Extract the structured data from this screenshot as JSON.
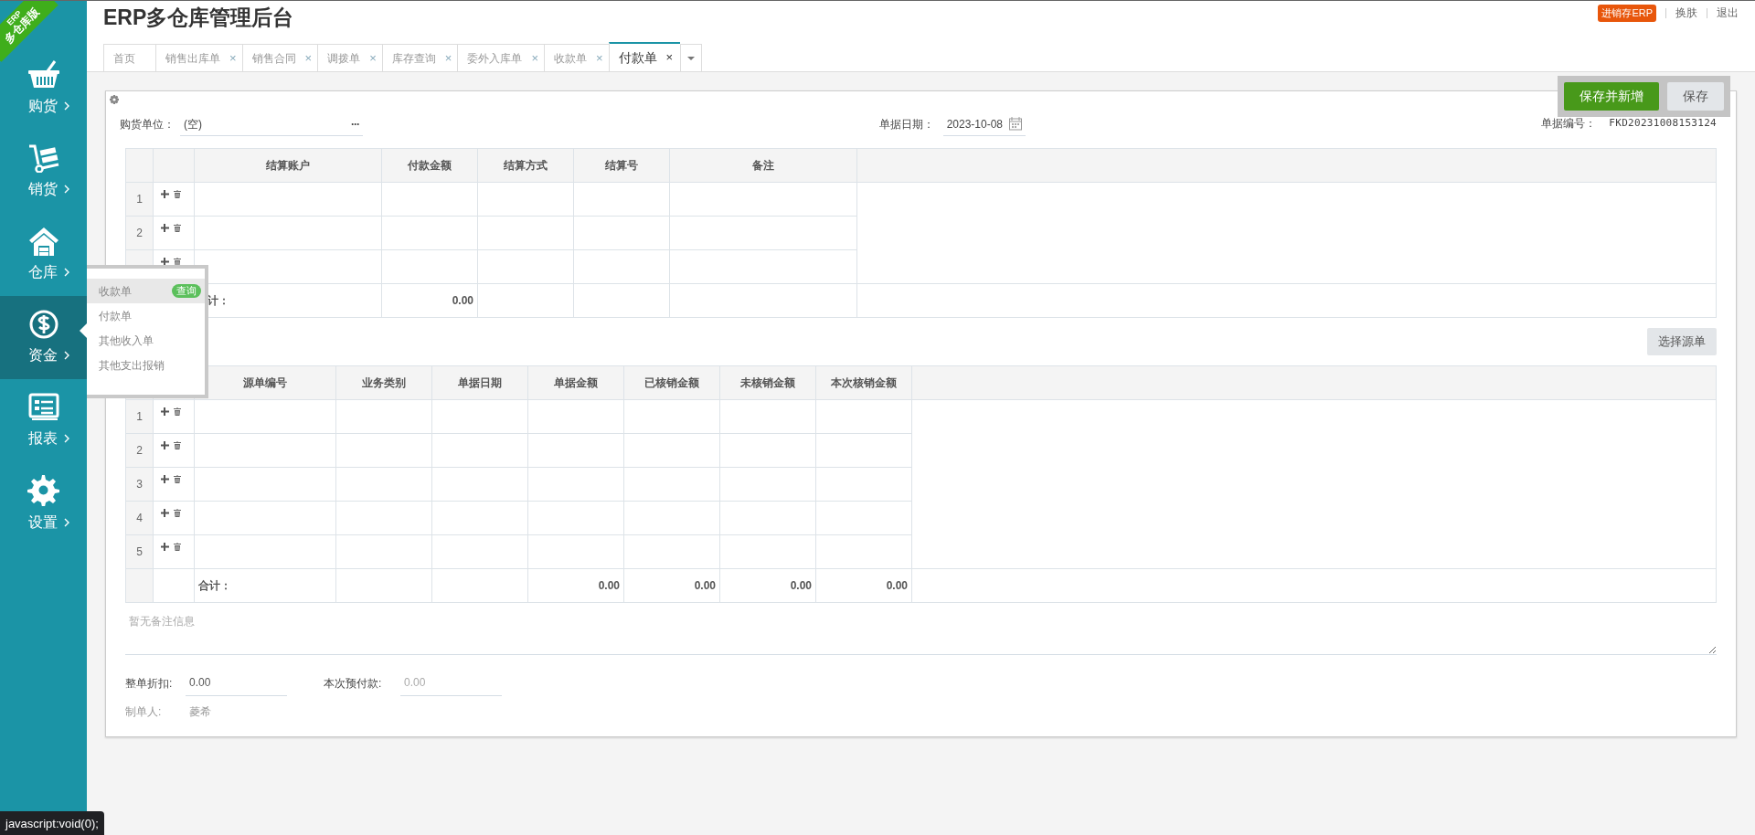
{
  "window": {
    "title": "ERP多仓库管理后台"
  },
  "corner_ribbon": {
    "line_1": "ERP",
    "line_2": "多仓库版"
  },
  "top_links": {
    "badge": "进销存ERP",
    "links": [
      "换肤",
      "退出"
    ]
  },
  "sidebar": {
    "items": [
      {
        "label": "购货",
        "selected": false
      },
      {
        "label": "销货",
        "selected": false
      },
      {
        "label": "仓库",
        "selected": false
      },
      {
        "label": "资金",
        "selected": true
      },
      {
        "label": "报表",
        "selected": false
      },
      {
        "label": "设置",
        "selected": false
      }
    ]
  },
  "flyout_menu": {
    "items": [
      {
        "label": "收款单",
        "highlighted": true,
        "badge": "查询"
      },
      {
        "label": "付款单",
        "highlighted": false
      },
      {
        "label": "其他收入单",
        "highlighted": false
      },
      {
        "label": "其他支出报销",
        "highlighted": false
      }
    ]
  },
  "tabs": [
    {
      "label": "首页",
      "selected": false
    },
    {
      "label": "销售出库单",
      "selected": false,
      "close": "×"
    },
    {
      "label": "销售合同",
      "selected": false,
      "close": "×"
    },
    {
      "label": "调拨单",
      "selected": false,
      "close": "×"
    },
    {
      "label": "库存查询",
      "selected": false,
      "close": "×"
    },
    {
      "label": "委外入库单",
      "selected": false,
      "close": "×"
    },
    {
      "label": "收款单",
      "selected": false,
      "close": "×"
    },
    {
      "label": "付款单",
      "selected": true,
      "close": "×"
    }
  ],
  "toolbar": {
    "buttons": [
      {
        "label": "保存并新增",
        "kind": "primary"
      },
      {
        "label": "保存",
        "kind": "secondary"
      }
    ]
  },
  "form": {
    "supplier": {
      "label": "购货单位：",
      "value": "(空)",
      "more": "···"
    },
    "date": {
      "label": "单据日期：",
      "value": "2023-10-08"
    },
    "number": {
      "label": "单据编号：",
      "value": "FKD20231008153124"
    }
  },
  "settlement_table": {
    "columns": [
      {
        "title": "结算账户"
      },
      {
        "title": "付款金额",
        "total": "0.00"
      },
      {
        "title": "结算方式"
      },
      {
        "title": "结算号"
      },
      {
        "title": "备注"
      }
    ],
    "rows": [
      {
        "number": "1"
      },
      {
        "number": "2"
      },
      {}
    ],
    "total_label": "计："
  },
  "select_source_button": "选择源单",
  "source_table": {
    "columns": [
      {
        "title": "源单编号"
      },
      {
        "title": "业务类别"
      },
      {
        "title": "单据日期"
      },
      {
        "title": "单据金额",
        "total": "0.00"
      },
      {
        "title": "已核销金额",
        "total": "0.00"
      },
      {
        "title": "未核销金额",
        "total": "0.00"
      },
      {
        "title": "本次核销金额",
        "total": "0.00"
      }
    ],
    "rows": [
      {
        "number": "1"
      },
      {
        "number": "2"
      },
      {
        "number": "3"
      },
      {
        "number": "4"
      },
      {
        "number": "5"
      }
    ],
    "total_label": "合计："
  },
  "note": {
    "placeholder": "暂无备注信息"
  },
  "summary": {
    "discount": {
      "label": "整单折扣:",
      "value": "0.00"
    },
    "prepayment": {
      "label": "本次预付款:",
      "value": "0.00",
      "disabled": true
    },
    "creator": {
      "label": "制单人:",
      "value": "菱希"
    }
  },
  "status_bar": {
    "text": "javascript:void(0);"
  }
}
